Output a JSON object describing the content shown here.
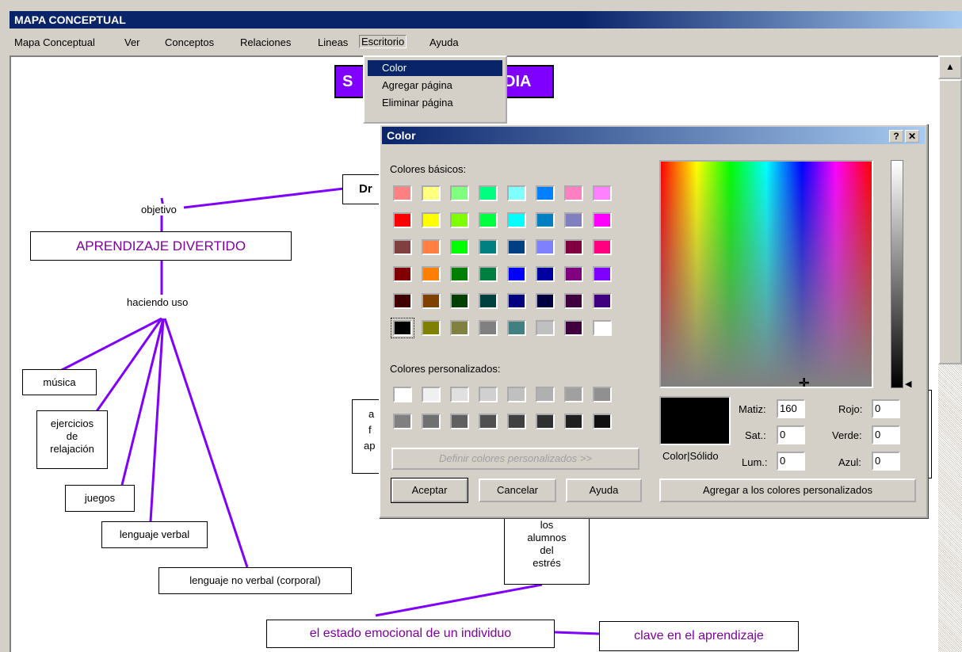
{
  "window": {
    "title": "MAPA CONCEPTUAL"
  },
  "menubar": {
    "items": [
      "Mapa Conceptual",
      "Ver",
      "Conceptos",
      "Relaciones",
      "Lineas",
      "Escritorio",
      "Ayuda"
    ],
    "open_menu": "Escritorio"
  },
  "dropdown": {
    "items": [
      "Color",
      "Agregar página",
      "Eliminar página"
    ],
    "selected": "Color"
  },
  "map": {
    "top_title_partial_left": "S",
    "top_title_partial_right": "DIA",
    "top_box_partial": "Dr",
    "nodes": {
      "objetivo": "objetivo",
      "aprendizaje": "APRENDIZAJE DIVERTIDO",
      "haciendo_uso": "haciendo uso",
      "musica": "música",
      "ejercicios": [
        "ejercicios",
        "de",
        "relajación"
      ],
      "juegos": "juegos",
      "lenguaje_verbal": "lenguaje verbal",
      "lenguaje_no_verbal": "lenguaje no verbal (corporal)",
      "hidden_box_lines": [
        "a",
        "f",
        "ap"
      ],
      "alumnos": [
        "los",
        "alumnos",
        "del",
        "estrés"
      ],
      "estado": "el estado emocional de un individuo",
      "clave": "clave en el aprendizaje"
    }
  },
  "dialog": {
    "title": "Color",
    "help_btn": "?",
    "close_btn": "✕",
    "basic_label": "Colores básicos:",
    "custom_label": "Colores personalizados:",
    "define_btn": "Definir colores personalizados >>",
    "accept_btn": "Aceptar",
    "cancel_btn": "Cancelar",
    "help_label": "Ayuda",
    "add_custom_btn": "Agregar a los colores personalizados",
    "color_solid": "Color|Sólido",
    "fields": {
      "matiz_label": "Matiz:",
      "matiz": "160",
      "sat_label": "Sat.:",
      "sat": "0",
      "lum_label": "Lum.:",
      "lum": "0",
      "rojo_label": "Rojo:",
      "rojo": "0",
      "verde_label": "Verde:",
      "verde": "0",
      "azul_label": "Azul:",
      "azul": "0"
    },
    "basic_colors": [
      "#ff8080",
      "#ffff80",
      "#80ff80",
      "#00ff80",
      "#80ffff",
      "#0080ff",
      "#ff80c0",
      "#ff80ff",
      "#ff0000",
      "#ffff00",
      "#80ff00",
      "#00ff40",
      "#00ffff",
      "#0080c0",
      "#8080c0",
      "#ff00ff",
      "#804040",
      "#ff8040",
      "#00ff00",
      "#008080",
      "#004080",
      "#8080ff",
      "#800040",
      "#ff0080",
      "#800000",
      "#ff8000",
      "#008000",
      "#008040",
      "#0000ff",
      "#0000a0",
      "#800080",
      "#8000ff",
      "#400000",
      "#804000",
      "#004000",
      "#004040",
      "#000080",
      "#000040",
      "#400040",
      "#400080",
      "#000000",
      "#808000",
      "#808040",
      "#808080",
      "#408080",
      "#c0c0c0",
      "#400040",
      "#ffffff"
    ],
    "custom_colors": [
      "#ffffff",
      "#f0f0f0",
      "#e0e0e0",
      "#d0d0d0",
      "#c0c0c0",
      "#b0b0b0",
      "#a0a0a0",
      "#909090",
      "#808080",
      "#707070",
      "#606060",
      "#505050",
      "#404040",
      "#303030",
      "#202020",
      "#101010"
    ],
    "preview_color": "#000000"
  }
}
